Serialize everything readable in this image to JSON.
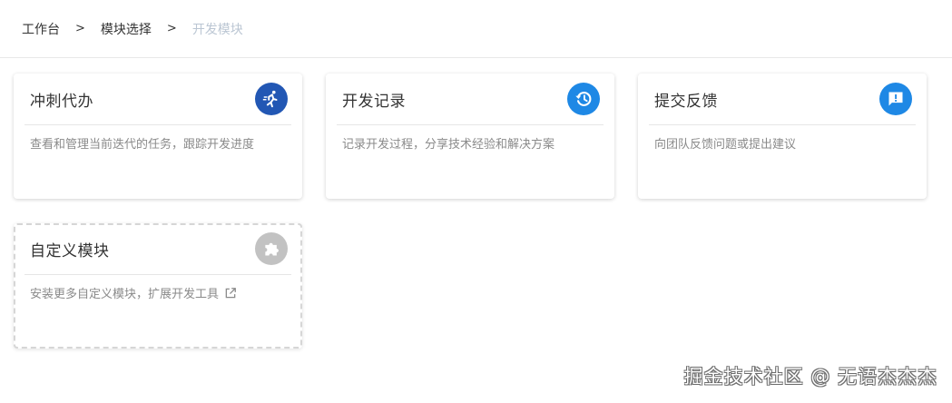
{
  "breadcrumb": {
    "items": [
      "工作台",
      "模块选择",
      "开发模块"
    ],
    "separator": ">"
  },
  "cards": [
    {
      "title": "冲刺代办",
      "description": "查看和管理当前迭代的任务，跟踪开发进度",
      "icon": "running-person-icon",
      "color": "#2257b4"
    },
    {
      "title": "开发记录",
      "description": "记录开发过程，分享技术经验和解决方案",
      "icon": "history-icon",
      "color": "#1e88e5"
    },
    {
      "title": "提交反馈",
      "description": "向团队反馈问题或提出建议",
      "icon": "feedback-icon",
      "color": "#1e88e5"
    },
    {
      "title": "自定义模块",
      "description": "安装更多自定义模块，扩展开发工具",
      "icon": "puzzle-icon",
      "color": "#c2c2c2"
    }
  ],
  "watermark": "掘金技术社区 @ 无语杰杰杰"
}
